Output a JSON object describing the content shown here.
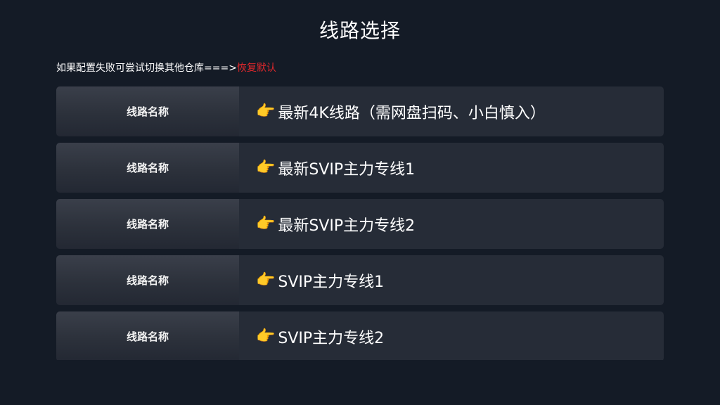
{
  "page": {
    "title": "线路选择"
  },
  "hint": {
    "text": "如果配置失败可尝试切换其他仓库===>",
    "restore_label": "恢复默认",
    "restore_color": "#e0282c"
  },
  "routes": [
    {
      "label": "线路名称",
      "icon": "pointing-hand-icon",
      "name": "最新4K线路（需网盘扫码、小白慎入）"
    },
    {
      "label": "线路名称",
      "icon": "pointing-hand-icon",
      "name": "最新SVIP主力专线1"
    },
    {
      "label": "线路名称",
      "icon": "pointing-hand-icon",
      "name": "最新SVIP主力专线2"
    },
    {
      "label": "线路名称",
      "icon": "pointing-hand-icon",
      "name": "SVIP主力专线1"
    },
    {
      "label": "线路名称",
      "icon": "pointing-hand-icon",
      "name": "SVIP主力专线2"
    }
  ],
  "colors": {
    "background": "#141b26",
    "row_background": "#262c37",
    "label_background": "#2c313b"
  }
}
